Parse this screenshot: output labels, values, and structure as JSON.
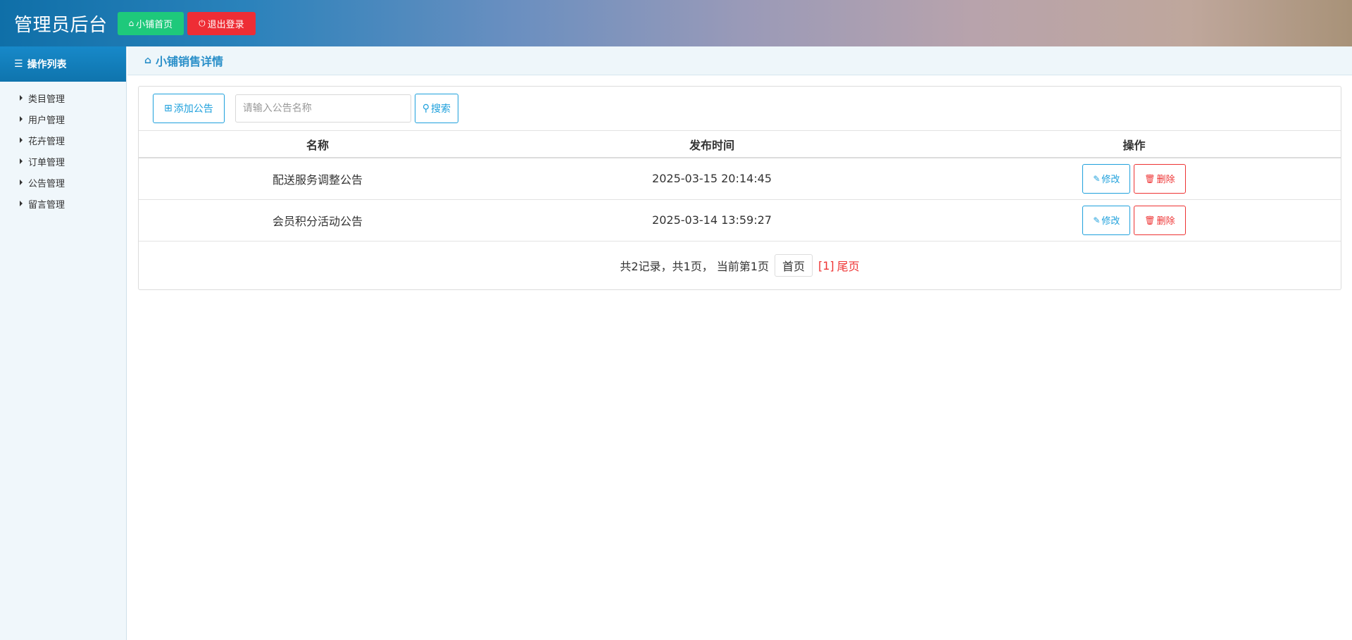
{
  "header": {
    "title": "管理员后台",
    "home_label": "小铺首页",
    "logout_label": "退出登录",
    "colors": {
      "home": "#1ec97b",
      "logout": "#ee2d35"
    }
  },
  "sidebar": {
    "title": "操作列表",
    "items": [
      {
        "label": "类目管理"
      },
      {
        "label": "用户管理"
      },
      {
        "label": "花卉管理"
      },
      {
        "label": "订单管理"
      },
      {
        "label": "公告管理"
      },
      {
        "label": "留言管理"
      }
    ]
  },
  "breadcrumb": {
    "title": "小铺销售详情"
  },
  "toolbar": {
    "add_label": "添加公告",
    "search_placeholder": "请输入公告名称",
    "search_value": "",
    "search_label": "搜索"
  },
  "table": {
    "headers": {
      "name": "名称",
      "time": "发布时间",
      "ops": "操作"
    },
    "rows": [
      {
        "name": "配送服务调整公告",
        "time": "2025-03-15 20:14:45",
        "edit": "修改",
        "delete": "删除"
      },
      {
        "name": "会员积分活动公告",
        "time": "2025-03-14 13:59:27",
        "edit": "修改",
        "delete": "删除"
      }
    ]
  },
  "pager": {
    "summary": "共2记录，共1页， 当前第1页",
    "first": "首页",
    "current": "[1]",
    "last": "尾页"
  }
}
